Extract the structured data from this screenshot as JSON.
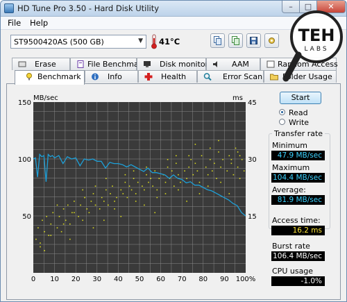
{
  "window": {
    "title": "HD Tune Pro 3.50 - Hard Disk Utility",
    "minimize": "–",
    "maximize": "□",
    "close": "✕"
  },
  "menu": {
    "file": "File",
    "help": "Help"
  },
  "drive": {
    "selected": "ST9500420AS (500 GB)",
    "temperature": "41°C"
  },
  "toolbar": {
    "icons": [
      "copy-info-icon",
      "copy-screen-icon",
      "save-icon",
      "options-icon"
    ]
  },
  "tabs_back": [
    {
      "label": "Erase",
      "icon": "erase-icon"
    },
    {
      "label": "File Benchmark",
      "icon": "file-benchmark-icon"
    },
    {
      "label": "Disk monitor",
      "icon": "disk-monitor-icon"
    },
    {
      "label": "AAM",
      "icon": "aam-icon"
    },
    {
      "label": "Random Access",
      "icon": "random-access-icon"
    }
  ],
  "tabs_front": [
    {
      "label": "Benchmark",
      "icon": "benchmark-icon"
    },
    {
      "label": "Info",
      "icon": "info-icon"
    },
    {
      "label": "Health",
      "icon": "health-icon"
    },
    {
      "label": "Error Scan",
      "icon": "error-scan-icon"
    },
    {
      "label": "Folder Usage",
      "icon": "folder-usage-icon"
    }
  ],
  "controls": {
    "start": "Start",
    "read": "Read",
    "write": "Write",
    "mode": "read"
  },
  "stats": {
    "transfer_rate": "Transfer rate",
    "minimum_label": "Minimum",
    "minimum": "47.9 MB/sec",
    "maximum_label": "Maximum",
    "maximum": "104.4 MB/sec",
    "average_label": "Average:",
    "average": "81.9 MB/sec",
    "access_time_label": "Access time:",
    "access_time": "16.2 ms",
    "burst_rate_label": "Burst rate",
    "burst_rate": "106.4 MB/sec",
    "cpu_usage_label": "CPU usage",
    "cpu_usage": "-1.0%"
  },
  "watermark": {
    "line1": "TEH",
    "line2": "LABS"
  },
  "colors": {
    "transfer_line": "#1ea0d8",
    "access_points": "#d8d81e",
    "chart_bg": "#3a3a3a",
    "grid": "#8a8a8a"
  },
  "chart_data": {
    "type": "line",
    "xlabel": "",
    "x_ticks": [
      "0",
      "10",
      "20",
      "30",
      "40",
      "50",
      "60",
      "70",
      "80",
      "90",
      "100%"
    ],
    "left_axis": {
      "unit": "MB/sec",
      "ticks": [
        "150",
        "100",
        "50"
      ],
      "range": [
        0,
        150
      ]
    },
    "right_axis": {
      "unit": "ms",
      "ticks": [
        "45",
        "30",
        "15"
      ],
      "range": [
        0,
        45
      ]
    },
    "grid": true,
    "series": [
      {
        "unit": "MB/sec",
        "x": [
          0,
          1,
          2,
          3,
          4,
          5,
          6,
          7,
          8,
          9,
          10,
          12,
          14,
          16,
          18,
          20,
          22,
          24,
          26,
          28,
          30,
          32,
          34,
          36,
          38,
          40,
          42,
          44,
          46,
          48,
          50,
          52,
          54,
          56,
          58,
          60,
          62,
          64,
          66,
          68,
          70,
          72,
          74,
          76,
          78,
          80,
          82,
          84,
          86,
          88,
          90,
          92,
          94,
          96,
          98,
          100
        ],
        "y": [
          100,
          101,
          84,
          104,
          102,
          103,
          80,
          104,
          102,
          103,
          101,
          103,
          96,
          102,
          100,
          101,
          94,
          100,
          99,
          100,
          98,
          98,
          92,
          97,
          96,
          96,
          95,
          93,
          95,
          93,
          91,
          89,
          92,
          88,
          88,
          87,
          86,
          83,
          86,
          83,
          82,
          79,
          80,
          77,
          77,
          75,
          73,
          72,
          70,
          68,
          66,
          64,
          61,
          59,
          53,
          50
        ]
      },
      {
        "unit": "ms",
        "scatter": true,
        "x": [
          1,
          2,
          3,
          4,
          5,
          6,
          7,
          8,
          9,
          11,
          12,
          13,
          14,
          15,
          16,
          17,
          18,
          19,
          21,
          22,
          23,
          24,
          25,
          26,
          27,
          28,
          29,
          31,
          32,
          33,
          34,
          35,
          36,
          37,
          38,
          39,
          41,
          42,
          43,
          44,
          45,
          46,
          47,
          48,
          49,
          51,
          52,
          53,
          54,
          55,
          56,
          57,
          58,
          59,
          61,
          62,
          63,
          64,
          65,
          66,
          67,
          68,
          69,
          71,
          72,
          73,
          74,
          75,
          76,
          77,
          78,
          79,
          81,
          82,
          83,
          84,
          85,
          86,
          87,
          88,
          89,
          91,
          92,
          93,
          94,
          95,
          96,
          97,
          98,
          99,
          3,
          8,
          14,
          19,
          24,
          29,
          33,
          38,
          43,
          48,
          53,
          58,
          63,
          68,
          73,
          78,
          83,
          88,
          93,
          97,
          5,
          11,
          17,
          23,
          28,
          34,
          41,
          47,
          52,
          57,
          62,
          67,
          72,
          76,
          82,
          87,
          92,
          96
        ],
        "y": [
          9,
          12,
          8,
          14,
          11,
          15,
          10,
          13,
          16,
          12,
          15,
          11,
          17,
          14,
          18,
          13,
          16,
          19,
          15,
          18,
          14,
          20,
          17,
          16,
          19,
          21,
          18,
          17,
          20,
          19,
          22,
          18,
          21,
          23,
          19,
          20,
          22,
          21,
          24,
          20,
          23,
          22,
          25,
          21,
          24,
          23,
          22,
          26,
          24,
          25,
          23,
          27,
          22,
          25,
          26,
          24,
          28,
          25,
          27,
          23,
          29,
          26,
          24,
          27,
          25,
          28,
          30,
          26,
          29,
          27,
          24,
          31,
          28,
          26,
          30,
          27,
          29,
          25,
          32,
          28,
          30,
          27,
          31,
          29,
          26,
          33,
          28,
          31,
          30,
          27,
          7,
          10,
          13,
          16,
          20,
          23,
          14,
          17,
          26,
          19,
          28,
          20,
          30,
          22,
          31,
          21,
          33,
          24,
          30,
          25,
          6,
          18,
          9,
          22,
          12,
          25,
          15,
          27,
          18,
          16,
          21,
          31,
          19,
          34,
          23,
          35,
          21,
          32
        ]
      }
    ]
  }
}
